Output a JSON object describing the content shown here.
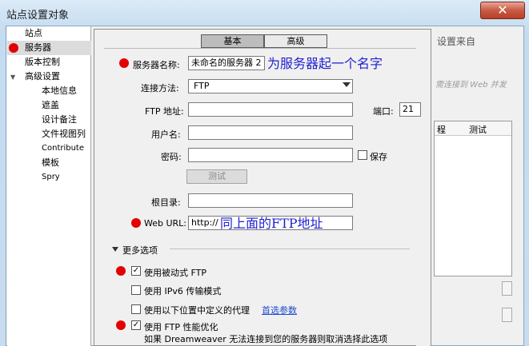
{
  "window": {
    "title": "站点设置对象",
    "close_glyph": "✕"
  },
  "sidebar": {
    "items": [
      {
        "label": "站点"
      },
      {
        "label": "服务器"
      },
      {
        "label": "版本控制"
      },
      {
        "label": "高级设置",
        "expander": "▼"
      },
      {
        "label": "本地信息"
      },
      {
        "label": "遮盖"
      },
      {
        "label": "设计备注"
      },
      {
        "label": "文件视图列"
      },
      {
        "label": "Contribute"
      },
      {
        "label": "模板"
      },
      {
        "label": "Spry"
      }
    ]
  },
  "background_panel": {
    "text_top": "设置来自",
    "text_italic": "需连接到 Web 并发",
    "table_headers": [
      "程",
      "测试"
    ]
  },
  "dialog": {
    "tabs": [
      {
        "label": "基本",
        "active": true
      },
      {
        "label": "高级",
        "active": false
      }
    ],
    "server_name": {
      "label": "服务器名称:",
      "value": "未命名的服务器 2"
    },
    "connect_method": {
      "label": "连接方法:",
      "value": "FTP"
    },
    "ftp_address": {
      "label": "FTP 地址:",
      "value": ""
    },
    "port": {
      "label": "端口:",
      "value": "21"
    },
    "username": {
      "label": "用户名:",
      "value": ""
    },
    "password": {
      "label": "密码:",
      "value": ""
    },
    "save": {
      "label": "保存",
      "checked": false
    },
    "test_button": "测试",
    "root_dir": {
      "label": "根目录:",
      "value": ""
    },
    "web_url": {
      "label": "Web URL:",
      "value": "http://"
    },
    "more_options": {
      "label": "更多选项",
      "expander": "▼"
    },
    "options": [
      {
        "label": "使用被动式 FTP",
        "checked": true
      },
      {
        "label": "使用 IPv6 传输模式",
        "checked": false
      },
      {
        "label": "使用以下位置中定义的代理",
        "link": "首选参数",
        "checked": false
      },
      {
        "label": "使用 FTP 性能优化",
        "checked": true
      }
    ],
    "note": "如果 Dreamweaver 无法连接到您的服务器则取消选择此选项"
  },
  "annotations": {
    "server_name_hint": "为服务器起一个名字",
    "web_url_hint": "同上面的FTP地址"
  },
  "colors": {
    "annotation_marker": "#e30000",
    "annotation_text": "#1f1fd0",
    "link": "#1f4bd0"
  }
}
